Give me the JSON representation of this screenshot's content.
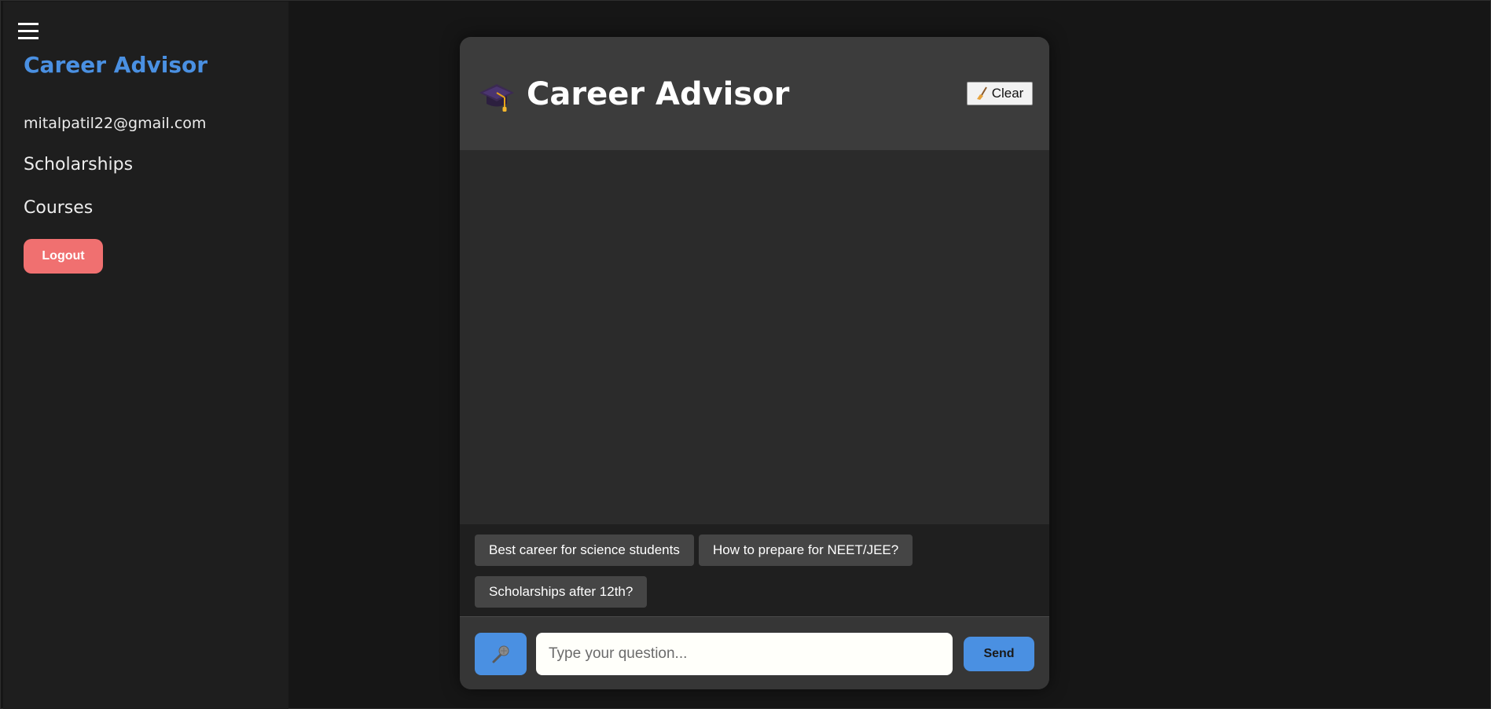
{
  "sidebar": {
    "brand": "Career Advisor",
    "email": "mitalpatil22@gmail.com",
    "nav": [
      {
        "label": "Scholarships"
      },
      {
        "label": "Courses"
      }
    ],
    "logout_label": "Logout"
  },
  "chat": {
    "title": "Career Advisor",
    "title_icon": "graduation-cap-icon",
    "clear_label": "Clear",
    "clear_icon": "broom-icon",
    "suggestions": [
      {
        "label": "Best career for science students"
      },
      {
        "label": "How to prepare for NEET/JEE?"
      },
      {
        "label": "Scholarships after 12th?"
      }
    ],
    "input": {
      "placeholder": "Type your question...",
      "value": ""
    },
    "mic_icon": "microphone-icon",
    "send_label": "Send"
  },
  "colors": {
    "accent": "#4a90e2",
    "logout": "#f07070",
    "background": "#161616",
    "sidebar": "#1e1e1e",
    "card_header": "#3c3c3c"
  }
}
